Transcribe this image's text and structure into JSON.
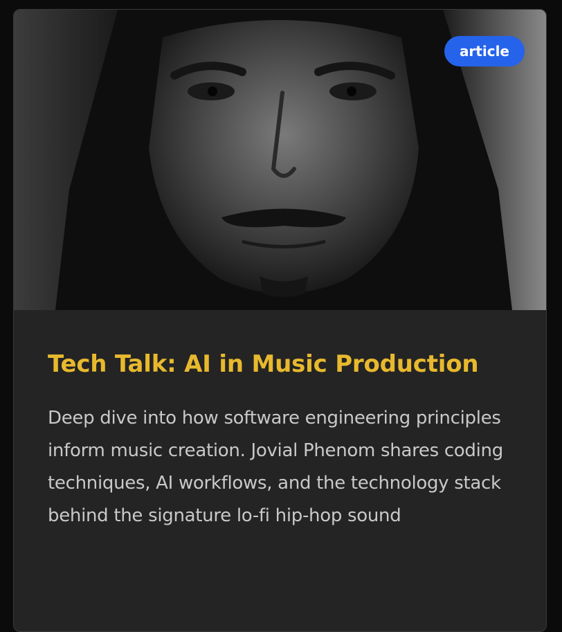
{
  "card": {
    "badge": "article",
    "title": "Tech Talk: AI in Music Production",
    "description": "Deep dive into how software engineering principles inform music creation. Jovial Phenom shares coding techniques, AI workflows, and the technology stack behind the signature lo-fi hip-hop sound",
    "image_subject": "black-and-white portrait photo",
    "colors": {
      "badge_bg": "#2563eb",
      "title": "#e8b92e",
      "card_bg": "#242424"
    }
  }
}
